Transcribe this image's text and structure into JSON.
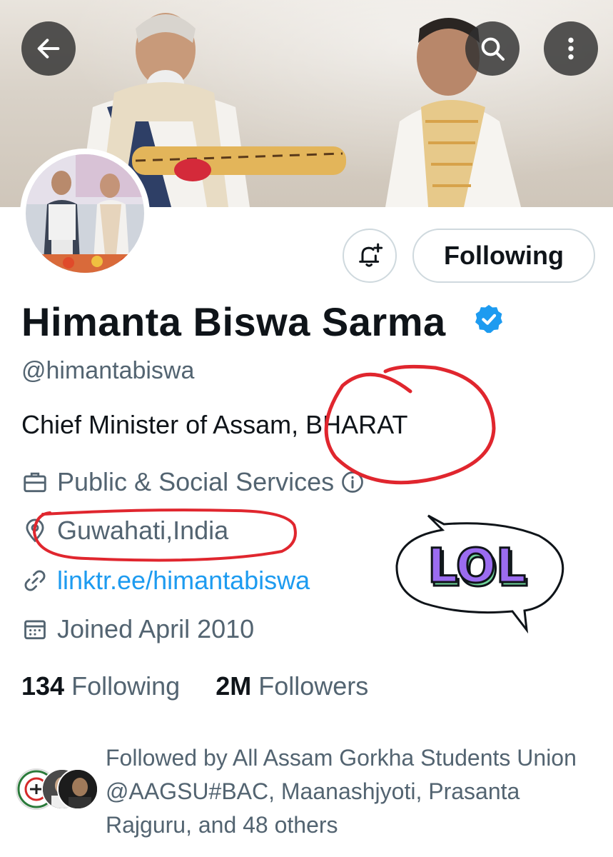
{
  "header": {
    "back_icon": "arrow-left-icon",
    "search_icon": "search-icon",
    "more_icon": "more-vertical-icon"
  },
  "profile": {
    "name": "Himanta Biswa Sarma",
    "handle": "@himantabiswa",
    "bio": "Chief Minister of Assam, BHARAT",
    "category": "Public & Social Services",
    "location": "Guwahati,India",
    "website": "linktr.ee/himantabiswa",
    "joined": "Joined April 2010",
    "following_count": "134",
    "following_label": "Following",
    "followers_count": "2M",
    "followers_label": "Followers",
    "followed_by": "Followed by All Assam Gorkha Students Union @AAGSU#BAC, Maanashjyoti, Prasanta Rajguru, and 48 others"
  },
  "buttons": {
    "notify_icon": "bell-plus-icon",
    "following_label": "Following"
  },
  "annotations": {
    "sticker_text": "LOL",
    "circle_color": "#e0262e"
  },
  "colors": {
    "link": "#1d9bf0",
    "secondary_text": "#536471",
    "verified": "#1d9bf0"
  }
}
